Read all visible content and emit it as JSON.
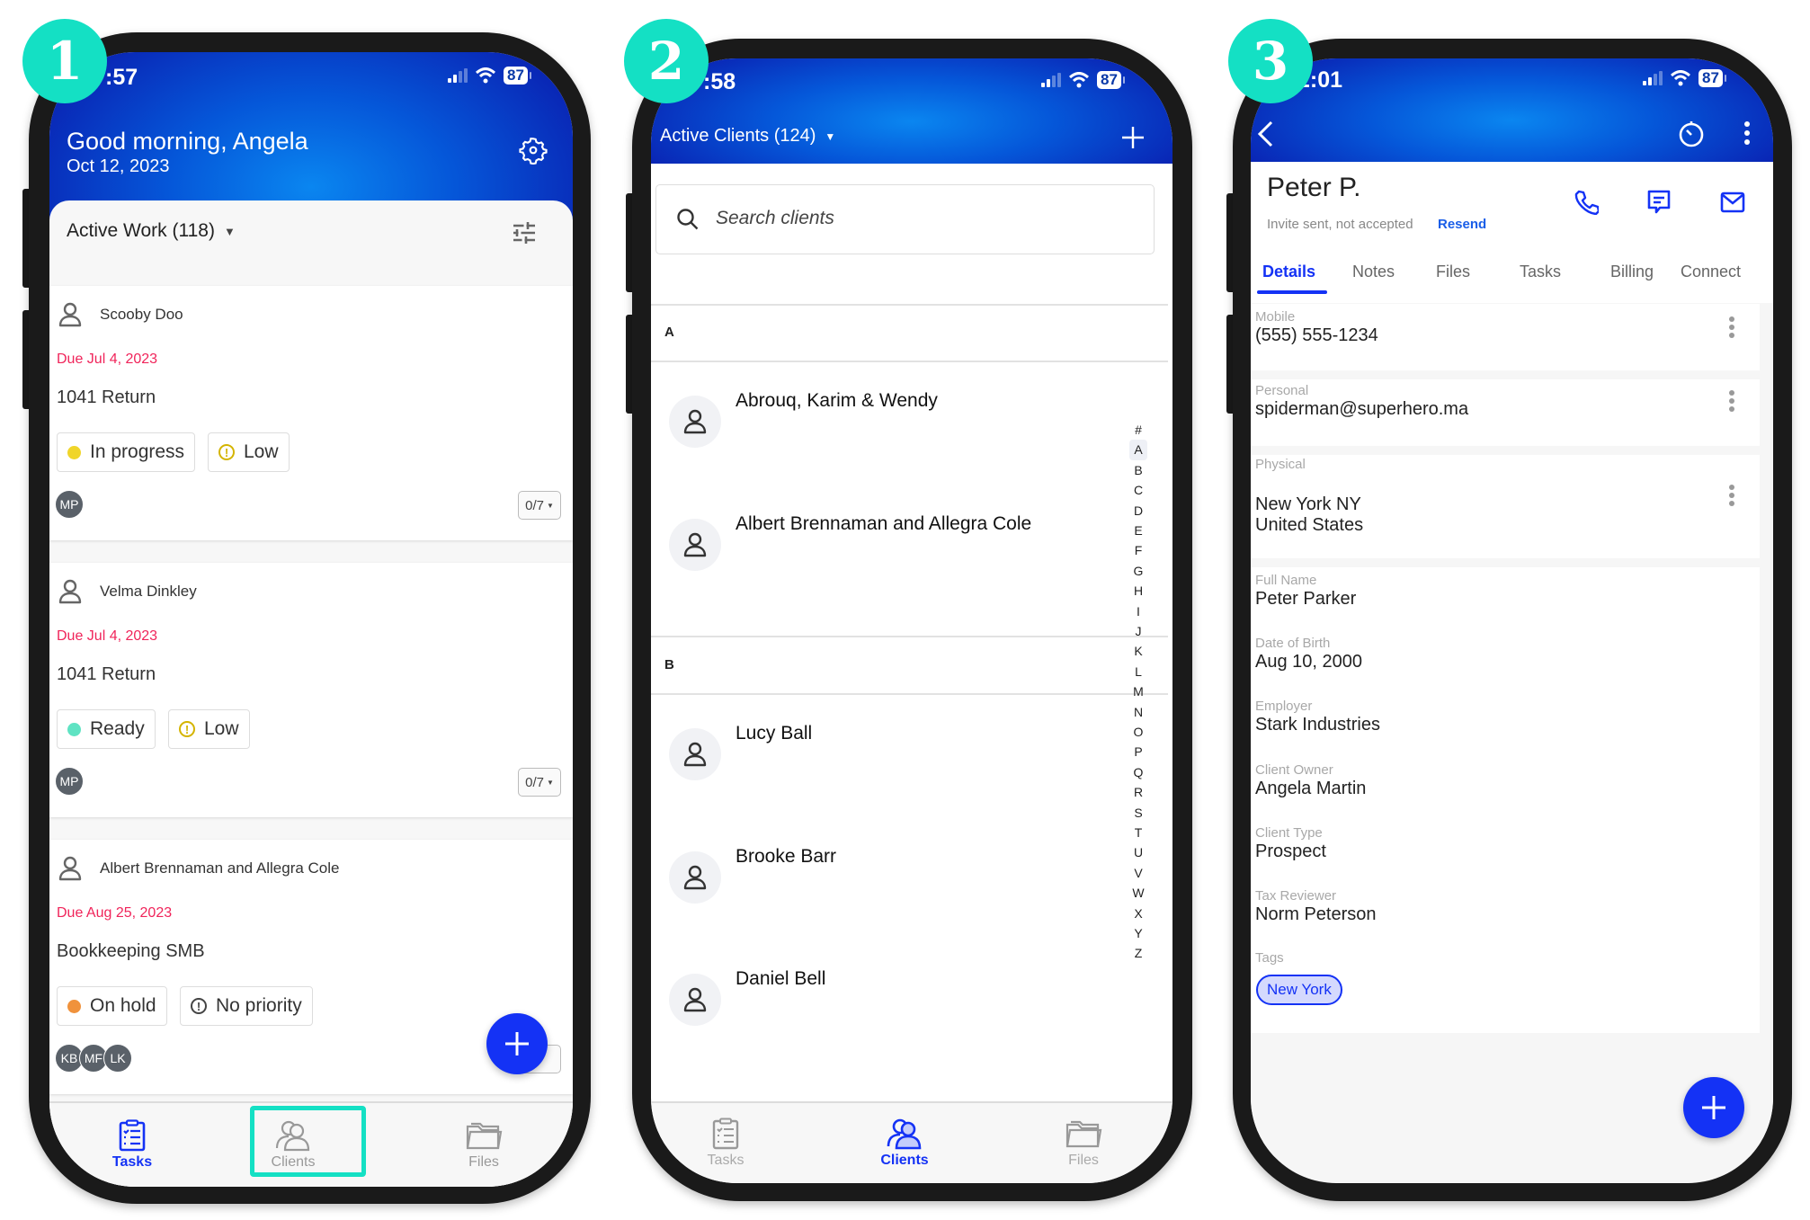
{
  "steps": [
    "1",
    "2",
    "3"
  ],
  "status_bar": {
    "battery": "87"
  },
  "phone1": {
    "time": ":57",
    "greeting": "Good morning, Angela",
    "date": "Oct 12, 2023",
    "filter_label": "Active Work (118)",
    "cards": [
      {
        "client": "Scooby Doo",
        "due": "Due Jul 4, 2023",
        "title": "1041 Return",
        "status": "In progress",
        "status_color": "#f0d52a",
        "priority": "Low",
        "assignees": [
          "MP"
        ],
        "progress": "0/7"
      },
      {
        "client": "Velma Dinkley",
        "due": "Due Jul 4, 2023",
        "title": "1041 Return",
        "status": "Ready",
        "status_color": "#5fe3c3",
        "priority": "Low",
        "assignees": [
          "MP"
        ],
        "progress": "0/7"
      },
      {
        "client": "Albert Brennaman and Allegra Cole",
        "due": "Due Aug 25, 2023",
        "title": "Bookkeeping SMB",
        "status": "On hold",
        "status_color": "#f0923c",
        "priority": "No priority",
        "assignees": [
          "KB",
          "MF",
          "LK"
        ],
        "progress": ""
      }
    ],
    "nav": [
      {
        "label": "Tasks",
        "active": true
      },
      {
        "label": "Clients",
        "active": false,
        "highlighted": true
      },
      {
        "label": "Files",
        "active": false
      }
    ]
  },
  "phone2": {
    "time": ":58",
    "title": "Active Clients (124)",
    "search_placeholder": "Search clients",
    "sections": [
      {
        "letter": "A",
        "clients": [
          "Abrouq, Karim & Wendy",
          "Albert Brennaman and Allegra Cole"
        ]
      },
      {
        "letter": "B",
        "clients": [
          "Lucy Ball",
          "Brooke Barr",
          "Daniel Bell"
        ]
      }
    ],
    "index": [
      "#",
      "A",
      "B",
      "C",
      "D",
      "E",
      "F",
      "G",
      "H",
      "I",
      "J",
      "K",
      "L",
      "M",
      "N",
      "O",
      "P",
      "Q",
      "R",
      "S",
      "T",
      "U",
      "V",
      "W",
      "X",
      "Y",
      "Z"
    ],
    "index_selected": "A",
    "nav": [
      {
        "label": "Tasks",
        "active": false
      },
      {
        "label": "Clients",
        "active": true
      },
      {
        "label": "Files",
        "active": false
      }
    ]
  },
  "phone3": {
    "time": "2:01",
    "name": "Peter P.",
    "invite_status": "Invite sent, not accepted",
    "resend": "Resend",
    "tabs": [
      "Details",
      "Notes",
      "Files",
      "Tasks",
      "Billing",
      "Connect"
    ],
    "active_tab": "Details",
    "contact_fields": [
      {
        "label": "Mobile",
        "value": "(555) 555-1234"
      },
      {
        "label": "Personal",
        "value": "spiderman@superhero.ma"
      },
      {
        "label": "Physical",
        "value": "New York NY",
        "value2": "United States"
      }
    ],
    "info_fields": [
      {
        "label": "Full Name",
        "value": "Peter Parker"
      },
      {
        "label": "Date of Birth",
        "value": "Aug 10, 2000"
      },
      {
        "label": "Employer",
        "value": "Stark Industries"
      },
      {
        "label": "Client Owner",
        "value": "Angela Martin"
      },
      {
        "label": "Client Type",
        "value": "Prospect"
      },
      {
        "label": "Tax Reviewer",
        "value": "Norm Peterson"
      }
    ],
    "tags_label": "Tags",
    "tags": [
      "New York"
    ]
  },
  "colors": {
    "accent": "#1432f5",
    "teal": "#14e0c4",
    "due": "#f0245a",
    "link": "#1a5ee8"
  }
}
